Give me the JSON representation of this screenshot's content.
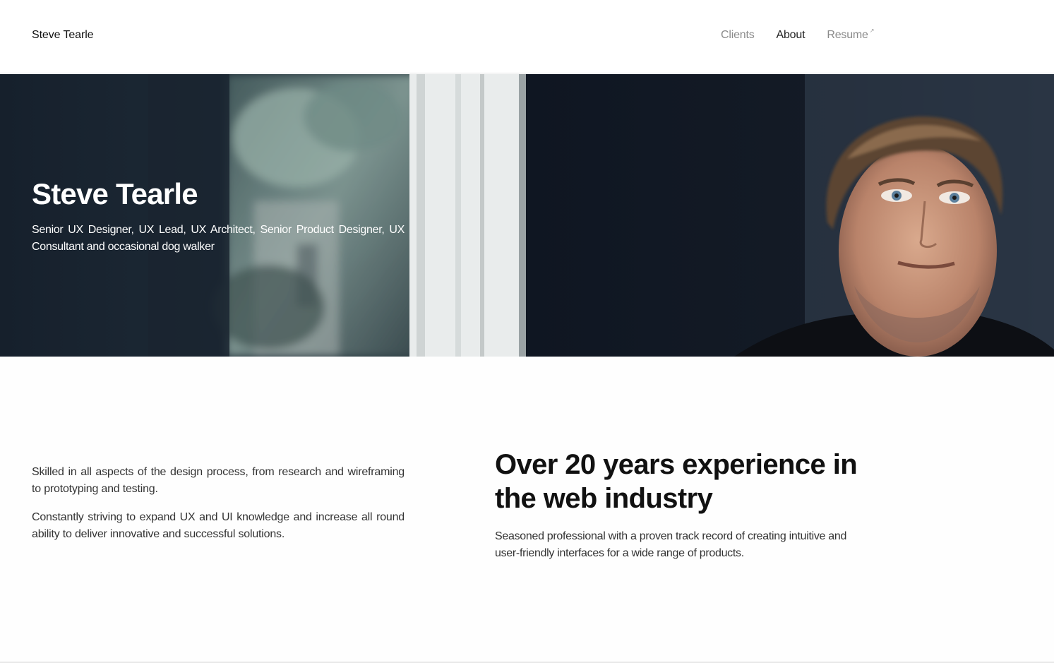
{
  "header": {
    "brand": "Steve Tearle",
    "nav": [
      {
        "label": "Clients",
        "active": false
      },
      {
        "label": "About",
        "active": true
      },
      {
        "label": "Resume",
        "active": false,
        "external_icon": "external-link-icon"
      }
    ]
  },
  "hero": {
    "title": "Steve Tearle",
    "subtitle": "Senior UX Designer, UX Lead, UX Architect, Senior Product Designer, UX Consultant and occasional dog walker"
  },
  "intro": {
    "paragraphs": [
      "Skilled in all aspects of the design process, from research and wireframing to prototyping and testing.",
      "Constantly striving to expand UX and UI knowledge and increase all round ability to deliver innovative and successful solutions."
    ]
  },
  "experience": {
    "heading": "Over 20 years experience in the web industry",
    "body": "Seasoned professional with a proven track record of creating intuitive and user-friendly interfaces for a wide range of products."
  }
}
